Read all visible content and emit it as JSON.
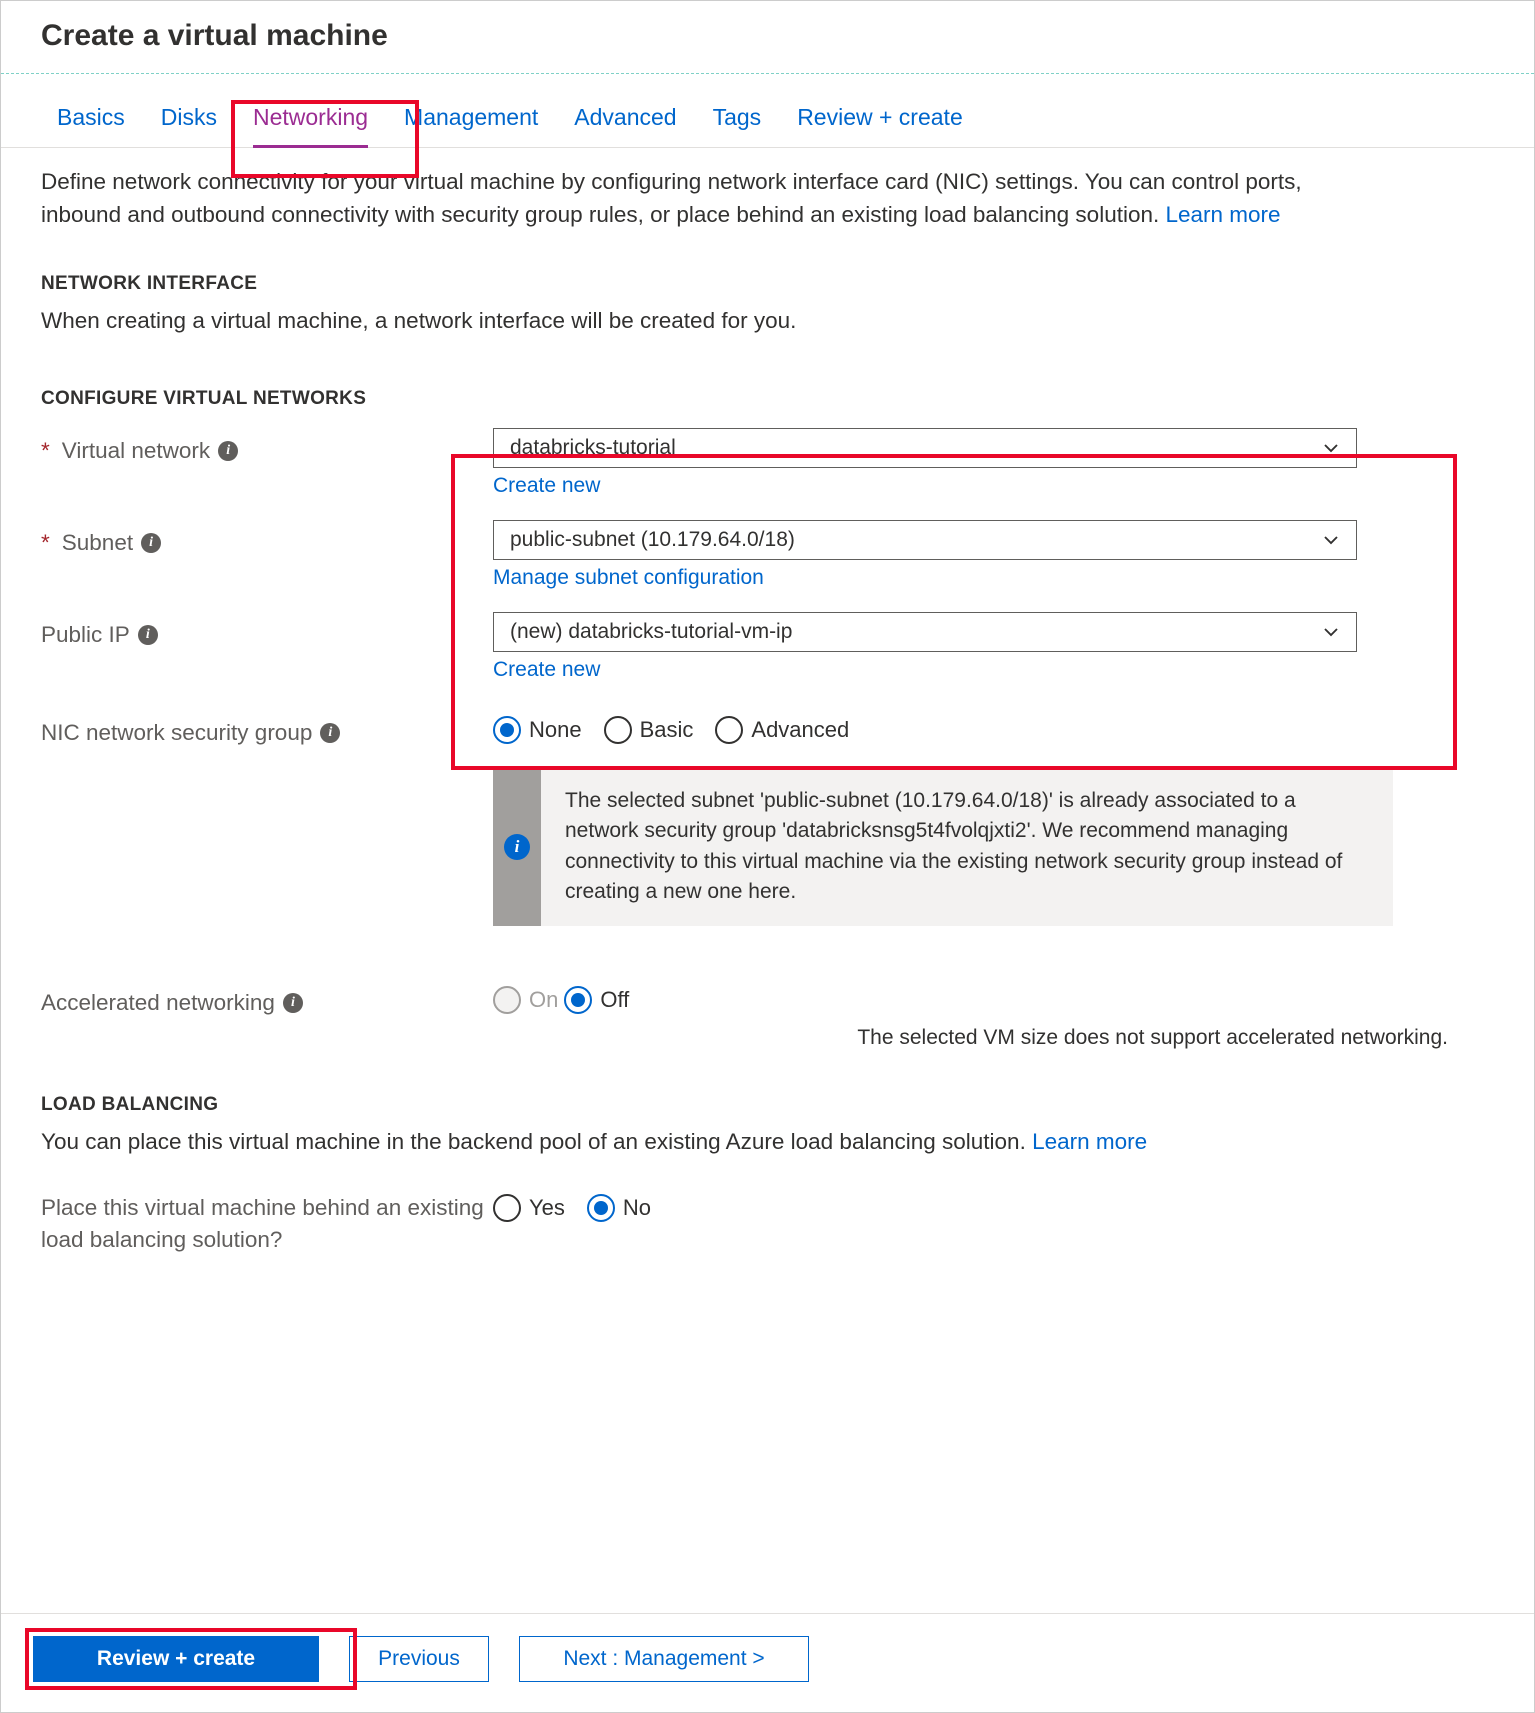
{
  "page_title": "Create a virtual machine",
  "tabs": {
    "basics": "Basics",
    "disks": "Disks",
    "networking": "Networking",
    "management": "Management",
    "advanced": "Advanced",
    "tags": "Tags",
    "review": "Review + create"
  },
  "intro": {
    "text": "Define network connectivity for your virtual machine by configuring network interface card (NIC) settings. You can control ports, inbound and outbound connectivity with security group rules, or place behind an existing load balancing solution.  ",
    "learn_more": "Learn more"
  },
  "network_interface": {
    "heading": "NETWORK INTERFACE",
    "sub": "When creating a virtual machine, a network interface will be created for you."
  },
  "configure_vnet": {
    "heading": "CONFIGURE VIRTUAL NETWORKS",
    "virtual_network": {
      "label": "Virtual network",
      "value": "databricks-tutorial",
      "create_new": "Create new"
    },
    "subnet": {
      "label": "Subnet",
      "value": "public-subnet (10.179.64.0/18)",
      "manage": "Manage subnet configuration"
    },
    "public_ip": {
      "label": "Public IP",
      "value": "(new) databricks-tutorial-vm-ip",
      "create_new": "Create new"
    }
  },
  "nsg": {
    "label": "NIC network security group",
    "options": {
      "none": "None",
      "basic": "Basic",
      "advanced": "Advanced"
    },
    "selected": "none",
    "info": "The selected subnet 'public-subnet (10.179.64.0/18)' is already associated to a network security group 'databricksnsg5t4fvolqjxti2'. We recommend managing connectivity to this virtual machine via the existing network security group instead of creating a new one here."
  },
  "accel_net": {
    "label": "Accelerated networking",
    "on": "On",
    "off": "Off",
    "selected": "off",
    "note": "The selected VM size does not support accelerated networking."
  },
  "load_balancing": {
    "heading": "LOAD BALANCING",
    "sub_text": "You can place this virtual machine in the backend pool of an existing Azure load balancing solution.  ",
    "learn_more": "Learn more",
    "question": "Place this virtual machine behind an existing load balancing solution?",
    "yes": "Yes",
    "no": "No",
    "selected": "no"
  },
  "footer": {
    "review": "Review + create",
    "previous": "Previous",
    "next": "Next : Management >"
  }
}
